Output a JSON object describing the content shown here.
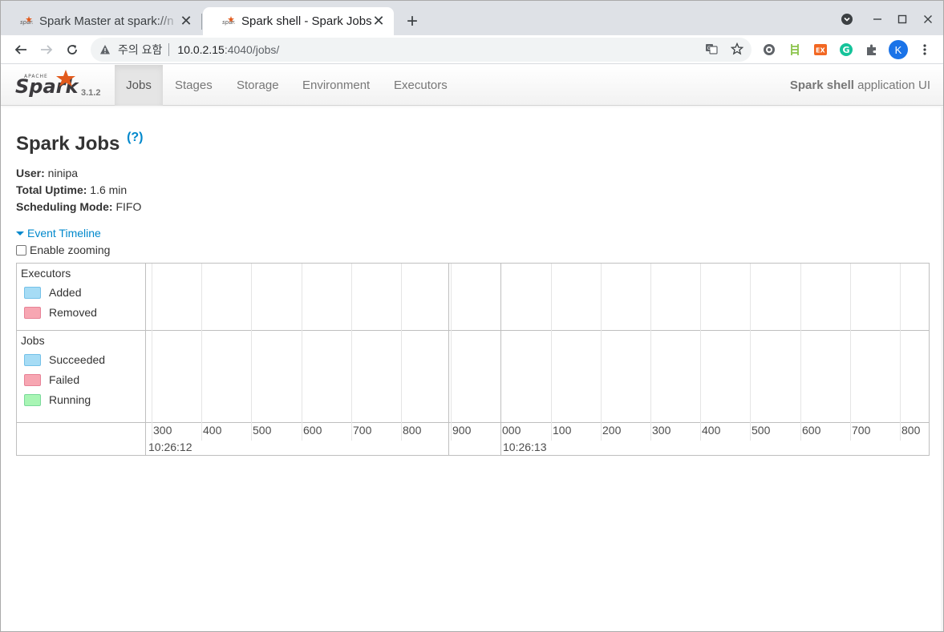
{
  "browser": {
    "tabs": [
      {
        "title": "Spark Master at spark://n",
        "active": false
      },
      {
        "title": "Spark shell - Spark Jobs",
        "active": true
      }
    ],
    "new_tab": "+",
    "security_label": "주의 요함",
    "url_host": "10.0.2.15",
    "url_path": ":4040/jobs/",
    "profile_initial": "K"
  },
  "spark_nav": {
    "version": "3.1.2",
    "items": [
      {
        "label": "Jobs",
        "active": true
      },
      {
        "label": "Stages",
        "active": false
      },
      {
        "label": "Storage",
        "active": false
      },
      {
        "label": "Environment",
        "active": false
      },
      {
        "label": "Executors",
        "active": false
      }
    ],
    "app_name": "Spark shell",
    "app_suffix": " application UI"
  },
  "page": {
    "title": "Spark Jobs",
    "help": "(?)",
    "info": [
      {
        "label": "User:",
        "value": " ninipa"
      },
      {
        "label": "Total Uptime:",
        "value": " 1.6 min"
      },
      {
        "label": "Scheduling Mode:",
        "value": " FIFO"
      }
    ],
    "event_timeline": "Event Timeline",
    "enable_zooming": "Enable zooming"
  },
  "timeline": {
    "groups": [
      {
        "title": "Executors",
        "legend": [
          {
            "label": "Added",
            "fill": "#a6dcf5",
            "border": "#74c1e8"
          },
          {
            "label": "Removed",
            "fill": "#f7a6b2",
            "border": "#e78296"
          }
        ]
      },
      {
        "title": "Jobs",
        "legend": [
          {
            "label": "Succeeded",
            "fill": "#a6dcf5",
            "border": "#74c1e8"
          },
          {
            "label": "Failed",
            "fill": "#f7a6b2",
            "border": "#e78296"
          },
          {
            "label": "Running",
            "fill": "#a8f5b4",
            "border": "#7ad99a"
          }
        ]
      }
    ],
    "ticks": [
      "300",
      "400",
      "500",
      "600",
      "700",
      "800",
      "900",
      "000",
      "100",
      "200",
      "300",
      "400",
      "500",
      "600",
      "700",
      "800"
    ],
    "major_labels": [
      "10:26:12",
      "10:26:13"
    ]
  }
}
